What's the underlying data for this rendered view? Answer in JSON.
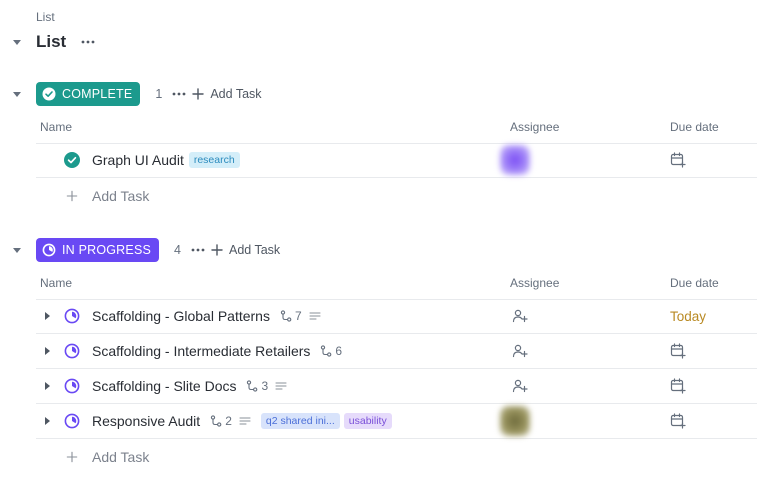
{
  "breadcrumb": "List",
  "page_title": "List",
  "columns": {
    "name": "Name",
    "assignee": "Assignee",
    "due": "Due date"
  },
  "colors": {
    "complete": "#1c9a8d",
    "in_progress": "#6949f4",
    "today": "#b98a24"
  },
  "groups": [
    {
      "status": "COMPLETE",
      "count": "1",
      "add_task": "Add Task",
      "add_task_row": "Add Task",
      "tasks": [
        {
          "name": "Graph UI Audit",
          "tags": [
            "research"
          ],
          "assignee": "avatar",
          "due_icon": "calendar-add-icon"
        }
      ]
    },
    {
      "status": "IN PROGRESS",
      "count": "4",
      "add_task": "Add Task",
      "add_task_row": "Add Task",
      "tasks": [
        {
          "name": "Scaffolding - Global Patterns",
          "subtasks": "7",
          "due": "Today",
          "assignee_icon": "add-person-icon"
        },
        {
          "name": "Scaffolding - Intermediate Retailers",
          "subtasks": "6",
          "assignee_icon": "add-person-icon",
          "due_icon": "calendar-add-icon"
        },
        {
          "name": "Scaffolding - Slite Docs",
          "subtasks": "3",
          "assignee_icon": "add-person-icon",
          "due_icon": "calendar-add-icon"
        },
        {
          "name": "Responsive Audit",
          "subtasks": "2",
          "tags": [
            "q2 shared ini...",
            "usability"
          ],
          "assignee": "avatar",
          "due_icon": "calendar-add-icon"
        }
      ]
    }
  ]
}
